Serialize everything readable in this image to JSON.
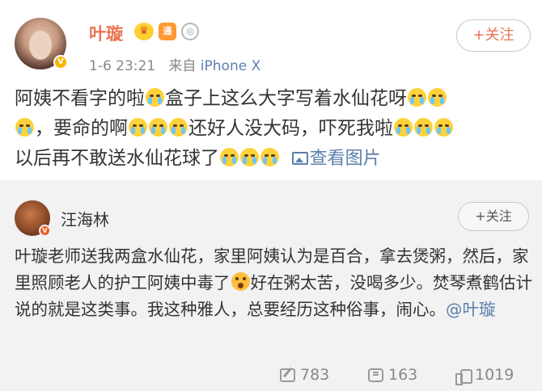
{
  "post": {
    "author_name": "叶璇",
    "verified_badge": "V",
    "badges": [
      {
        "icon": "vip-crown-icon",
        "glyph": "♛"
      },
      {
        "icon": "member-icon",
        "glyph": "通"
      },
      {
        "icon": "rank-medal-icon",
        "glyph": "◎"
      }
    ],
    "timestamp": "1-6 23:21",
    "source_prefix": "来自",
    "source_device": "iPhone X",
    "follow_label": "+关注",
    "text_segments": [
      "阿姨不看字的啦",
      "盒子上这么大字写着水仙花呀",
      "，要命的啊",
      "还好人没大码，吓死我啦",
      "以后再不敢送水仙花球了"
    ],
    "view_images_label": "查看图片"
  },
  "repost": {
    "author_name": "汪海林",
    "verified_badge": "V",
    "follow_label": "+关注",
    "text_before_emoji": "叶璇老师送我两盒水仙花，家里阿姨认为是百合，拿去煲粥，然后，家里照顾老人的护工阿姨中毒了",
    "text_after_emoji": "好在粥太苦，没喝多少。焚琴煮鹤估计说的就是这类事。我这种雅人，总要经历这种俗事，闹心。",
    "mention": "@叶璇"
  },
  "actions": {
    "repost_count": "783",
    "comment_count": "163",
    "like_count": "1019"
  },
  "colors": {
    "name_orange": "#eb7350",
    "link_blue": "#5b7fad",
    "repost_bg": "#f2f2f2",
    "meta_gray": "#888888"
  }
}
